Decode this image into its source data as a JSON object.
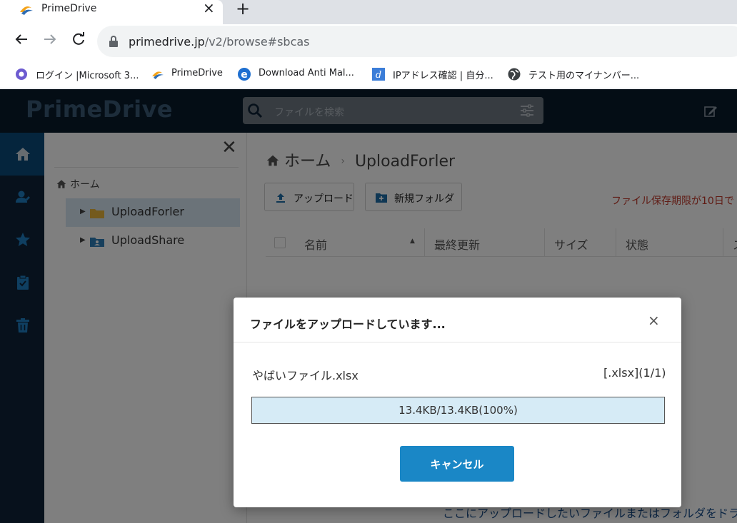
{
  "browser": {
    "tab_title": "PrimeDrive",
    "tab_close": "×",
    "new_tab": "+",
    "url_domain": "primedrive.jp",
    "url_path": "/v2/browse#sbcas",
    "bookmarks": [
      {
        "label": "ログイン |Microsoft 3...",
        "icon": "microsoft-office-icon"
      },
      {
        "label": "PrimeDrive",
        "icon": "primedrive-icon"
      },
      {
        "label": "Download Anti Mal...",
        "icon": "edge-icon"
      },
      {
        "label": "IPアドレス確認 | 自分...",
        "icon": "ip-check-icon"
      },
      {
        "label": "テスト用のマイナンバー...",
        "icon": "globe-icon"
      }
    ]
  },
  "app": {
    "logo": "PrimeDrive",
    "search_placeholder": "ファイルを検索",
    "tree": {
      "close": "✕",
      "home": "ホーム",
      "nodes": [
        {
          "label": "UploadForler",
          "selected": true
        },
        {
          "label": "UploadShare",
          "selected": false
        }
      ]
    },
    "breadcrumb": {
      "home": "ホーム",
      "sep": "›",
      "current": "UploadForler"
    },
    "toolbar": {
      "upload": "アップロード",
      "new_folder": "新規フォルダ"
    },
    "notice": "ファイル保存期限が10日で",
    "columns": {
      "name": "名前",
      "modified": "最終更新",
      "size": "サイズ",
      "status": "状態",
      "more": "ス"
    },
    "drop_hint": "ここにアップロードしたいファイルまたはフォルダをドラッグ"
  },
  "modal": {
    "title": "ファイルをアップロードしています...",
    "close": "×",
    "file_name": "やばいファイル.xlsx",
    "file_count": "[.xlsx](1/1)",
    "progress_text": "13.4KB/13.4KB(100%)",
    "progress_fraction": 1.0,
    "cancel": "キャンセル"
  },
  "colors": {
    "header_bg": "#081a2b",
    "accent_blue": "#1a87c6",
    "progress_fill": "#d6ebf6",
    "notice_red": "#c0392b"
  }
}
